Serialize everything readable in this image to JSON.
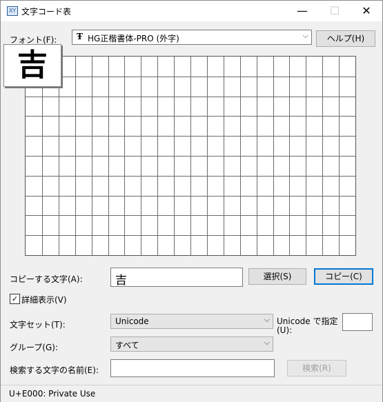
{
  "window": {
    "title": "文字コード表",
    "app_icon_label": "XY",
    "minimize": "—",
    "maximize": "☐",
    "close": "✕"
  },
  "font": {
    "label": "フォント(F):",
    "selected": "HG正楷書体-PRO (外字)",
    "font_type_icon": "Ŧ",
    "help_button": "ヘルプ(H)"
  },
  "grid": {
    "rows": 10,
    "cols": 20,
    "preview_char": "吉"
  },
  "copy": {
    "label": "コピーする文字(A):",
    "value": "吉",
    "select_button": "選択(S)",
    "copy_button": "コピー(C)"
  },
  "advanced": {
    "checkbox_label": "詳細表示(V)",
    "checked": true,
    "check_mark": "✓",
    "charset_label": "文字セット(T):",
    "charset_value": "Unicode",
    "unicode_spec_label_1": "Unicode で指定",
    "unicode_spec_label_2": "(U):",
    "unicode_spec_value": "",
    "group_label": "グループ(G):",
    "group_value": "すべて",
    "search_label": "検索する文字の名前(E):",
    "search_value": "",
    "search_button": "検索(R)"
  },
  "status": {
    "text": "U+E000: Private Use"
  }
}
